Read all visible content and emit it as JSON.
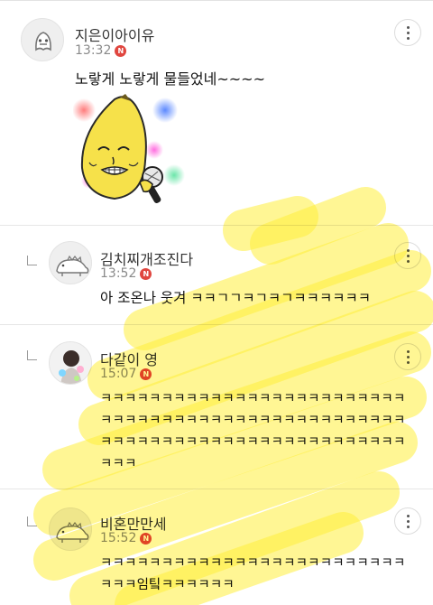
{
  "comments": [
    {
      "nickname": "지은이아이유",
      "time": "13:32",
      "badge": "N",
      "text": "노랗게 노랗게 물들었네~~~~",
      "sticker": "banana-singing-sticker",
      "is_reply": false
    },
    {
      "nickname": "김치찌개조진다",
      "time": "13:52",
      "badge": "N",
      "text": "아 조온나 웃겨 ㅋㅋㄱㄱㅋㄱㅋㄱㅋㅋㅋㅋㅋㅋ",
      "is_reply": true
    },
    {
      "nickname": "다같이 영",
      "time": "15:07",
      "badge": "N",
      "text": "ㅋㅋㅋㅋㅋㅋㅋㅋㅋㅋㅋㅋㅋㅋㅋㅋㅋㅋㅋㅋㅋㅋㅋㅋㅋㅋㅋㅋㅋㅋㅋㅋㅋㅋㅋㅋㅋㅋㅋㅋㅋㅋㅋㅋㅋㅋㅋㅋㅋㅋㅋㅋㅋㅋㅋㅋㅋㅋㅋㅋㅋㅋㅋㅋㅋㅋㅋㅋㅋㅋㅋㅋㅋㅋㅋㅋㅋㅋ",
      "is_reply": true
    },
    {
      "nickname": "비혼만만세",
      "time": "15:52",
      "badge": "N",
      "text": "ㅋㅋㅋㅋㅋㅋㅋㅋㅋㅋㅋㅋㅋㅋㅋㅋㅋㅋㅋㅋㅋㅋㅋㅋㅋㅋㅋㅋ임팈ㅋㅋㅋㅋㅋㅋ",
      "is_reply": true
    }
  ],
  "colors": {
    "highlight": "#ffee3c",
    "badge": "#e0463f",
    "time": "#8a8a8a"
  },
  "icons": [
    "more-options-icon",
    "reply-arrow-icon",
    "new-badge-icon"
  ]
}
